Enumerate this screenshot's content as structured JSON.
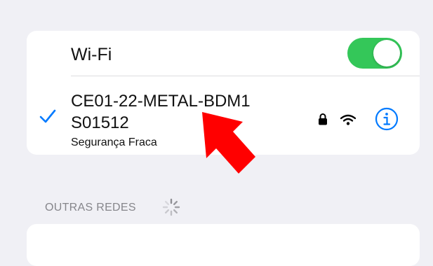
{
  "wifi": {
    "label": "Wi-Fi",
    "enabled": true,
    "toggle_color": "#34c759"
  },
  "connected_network": {
    "name": "CE01-22-METAL-BDM1S01512",
    "subtitle": "Segurança Fraca",
    "icons": [
      "checkmark-icon",
      "lock-icon",
      "wifi-signal-icon",
      "info-icon"
    ]
  },
  "other_networks": {
    "title": "OUTRAS REDES",
    "loading": true
  },
  "annotation": {
    "type": "arrow",
    "color": "#ff0000"
  },
  "colors": {
    "accent": "#007aff",
    "background": "#f0f0f5",
    "secondary_text": "#86868b"
  }
}
